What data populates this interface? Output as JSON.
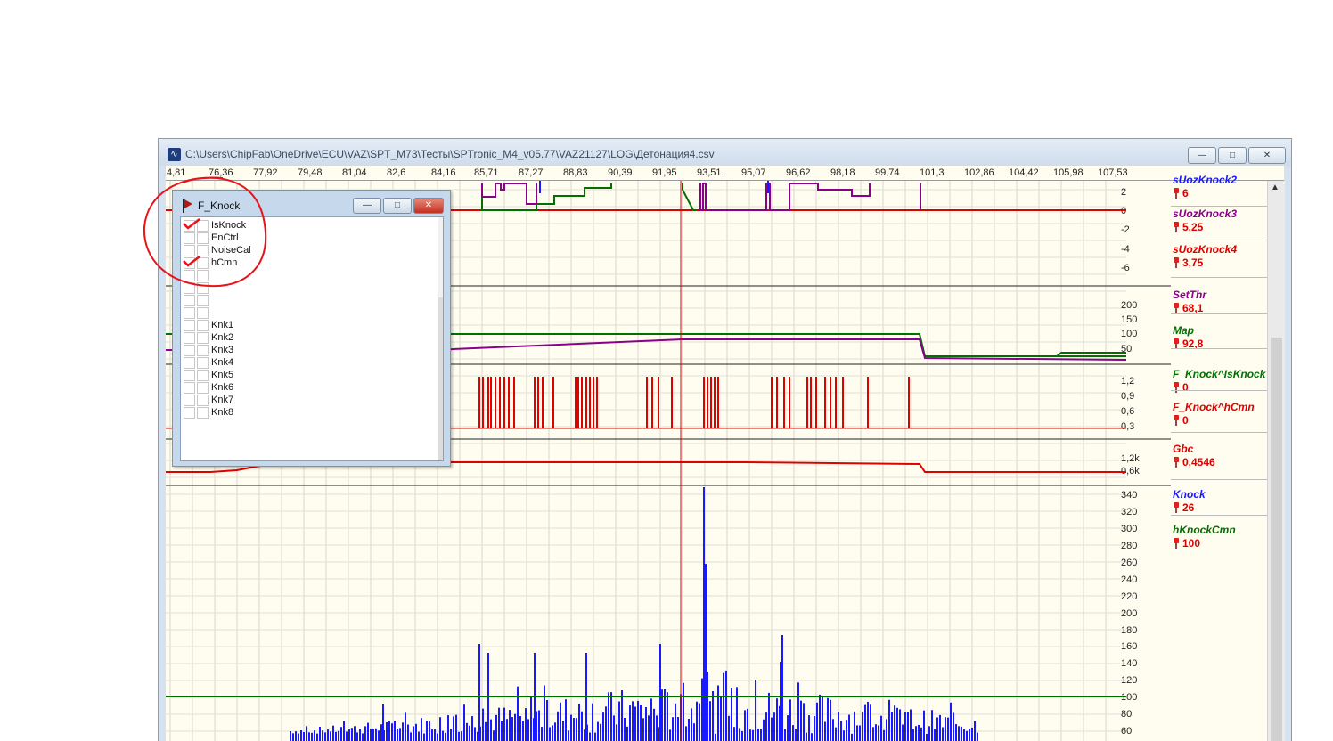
{
  "window": {
    "title": "C:\\Users\\ChipFab\\OneDrive\\ECU\\VAZ\\SPT_M73\\Тесты\\SPTronic_M4_v05.77\\VAZ21127\\LOG\\Детонация4.csv",
    "buttons": {
      "minimize": "—",
      "maximize": "□",
      "close": "✕"
    }
  },
  "top_axis": {
    "ticks": [
      "4,81",
      "76,36",
      "77,92",
      "79,48",
      "81,04",
      "82,6",
      "84,16",
      "85,71",
      "87,27",
      "88,83",
      "90,39",
      "91,95",
      "93,51",
      "95,07",
      "96,62",
      "98,18",
      "99,74",
      "101,3",
      "102,86",
      "104,42",
      "105,98",
      "107,53"
    ]
  },
  "panels": [
    {
      "y_ticks": [
        "2",
        "0",
        "-2",
        "-4",
        "-6"
      ]
    },
    {
      "y_ticks": [
        "200",
        "150",
        "100",
        "50"
      ]
    },
    {
      "y_ticks": [
        "1,2",
        "0,9",
        "0,6",
        "0,3"
      ]
    },
    {
      "y_ticks": [
        "1,2k",
        "0,6k"
      ]
    },
    {
      "y_ticks": [
        "340",
        "320",
        "300",
        "280",
        "260",
        "240",
        "220",
        "200",
        "180",
        "160",
        "140",
        "120",
        "100",
        "80",
        "60"
      ]
    }
  ],
  "legend": [
    {
      "name": "sUozKnock2",
      "value": "6",
      "color": "#1a1aff"
    },
    {
      "name": "sUozKnock3",
      "value": "5,25",
      "color": "#8a008a"
    },
    {
      "name": "sUozKnock4",
      "value": "3,75",
      "color": "#e00000"
    },
    {
      "name": "SetThr",
      "value": "68,1",
      "color": "#8a008a"
    },
    {
      "name": "Map",
      "value": "92,8",
      "color": "#007000"
    },
    {
      "name": "F_Knock^IsKnock",
      "value": "0",
      "color": "#007000"
    },
    {
      "name": "F_Knock^hCmn",
      "value": "0",
      "color": "#e00000"
    },
    {
      "name": "Gbc",
      "value": "0,4546",
      "color": "#e00000"
    },
    {
      "name": "Knock",
      "value": "26",
      "color": "#1a1aff"
    },
    {
      "name": "hKnockCmn",
      "value": "100",
      "color": "#007000"
    }
  ],
  "flags_window": {
    "title": "F_Knock",
    "items": [
      {
        "label": "IsKnock",
        "checked": true
      },
      {
        "label": "EnCtrl",
        "checked": false
      },
      {
        "label": "NoiseCal",
        "checked": false
      },
      {
        "label": "hCmn",
        "checked": true
      },
      {
        "label": "",
        "checked": false
      },
      {
        "label": "",
        "checked": false
      },
      {
        "label": "",
        "checked": false
      },
      {
        "label": "",
        "checked": false
      },
      {
        "label": "Knk1",
        "checked": false
      },
      {
        "label": "Knk2",
        "checked": false
      },
      {
        "label": "Knk3",
        "checked": false
      },
      {
        "label": "Knk4",
        "checked": false
      },
      {
        "label": "Knk5",
        "checked": false
      },
      {
        "label": "Knk6",
        "checked": false
      },
      {
        "label": "Knk7",
        "checked": false
      },
      {
        "label": "Knk8",
        "checked": false
      }
    ]
  },
  "colors": {
    "grid": "#d4d4cc",
    "cursor": "#e00000",
    "plot_bg": "#fffdf0"
  }
}
